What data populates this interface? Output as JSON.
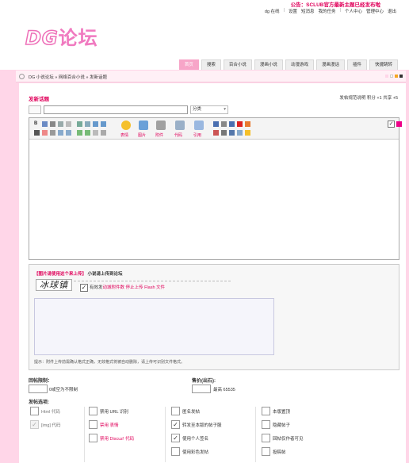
{
  "top": {
    "notice": "公告：SCLUB官方最新主题已经发布啦",
    "links": [
      "dg 在线",
      "设置",
      "短消息",
      "我的任务",
      "个人中心",
      "管理中心",
      "退出"
    ]
  },
  "logo": {
    "prefix": "DG",
    "suffix": "论坛"
  },
  "nav": {
    "items": [
      "首页",
      "搜索",
      "百合小说",
      "漫画小说",
      "动漫游戏",
      "漫画漫话",
      "插件",
      "快捷跳转"
    ],
    "active_index": 0
  },
  "breadcrumb": {
    "text": "DG 小说论坛 » 网络百合小说 » 发新话题"
  },
  "post": {
    "title": "发新话题",
    "info": "发帖规范说明 积分 +1 共享 +5",
    "subject_value": "",
    "category_value": "分类"
  },
  "editor": {
    "labels": [
      "表情",
      "图片",
      "附件",
      "代码",
      "引用"
    ]
  },
  "attach": {
    "title_red": "【图片请使用这个来上传】",
    "title_rest": " 小说请上传到论坛",
    "captcha": "冰球镇",
    "check_mark": "✓",
    "note_prefix": "有效发",
    "note_pink": "动城附件数 停止上传 Flash 文件",
    "hint": "提示：附件上传前需确认格式正确，无效格式将被自动删除，请上传可识别文件格式。"
  },
  "options": {
    "reply_limit_label": "回帖限制：",
    "reply_limit_hint": "0或空为不限制",
    "price_label": "售价(出石):",
    "price_hint": "最高 65535",
    "post_options_label": "发帖选项:",
    "checkboxes": [
      {
        "label": "Html 代码",
        "checked": false,
        "disabled": false
      },
      {
        "label": "[img] 代码",
        "checked": true,
        "disabled": true
      },
      {
        "label": "禁用 URL 识别",
        "checked": false,
        "disabled": false
      },
      {
        "label": "禁用 表情",
        "checked": false,
        "disabled": false
      },
      {
        "label": "禁用 Discuz! 代码",
        "checked": false,
        "disabled": false
      },
      {
        "label": "匿名发帖",
        "checked": false,
        "disabled": false
      },
      {
        "label": "转发至本版的帖子服",
        "checked": true,
        "disabled": false
      },
      {
        "label": "使用个人签名",
        "checked": true,
        "disabled": false
      },
      {
        "label": "使用彩色发帖",
        "checked": false,
        "disabled": false
      },
      {
        "label": "本版置顶",
        "checked": false,
        "disabled": false
      },
      {
        "label": "隐藏帖子",
        "checked": false,
        "disabled": false
      },
      {
        "label": "回帖仅作者可见",
        "checked": false,
        "disabled": false
      },
      {
        "label": "投稿帖",
        "checked": false,
        "disabled": false
      }
    ]
  },
  "colors": {
    "accent": "#e0005a",
    "page_bg": "#ffd6e8",
    "logo": "#f07ac0",
    "nav_active": "#f7a5c8"
  }
}
